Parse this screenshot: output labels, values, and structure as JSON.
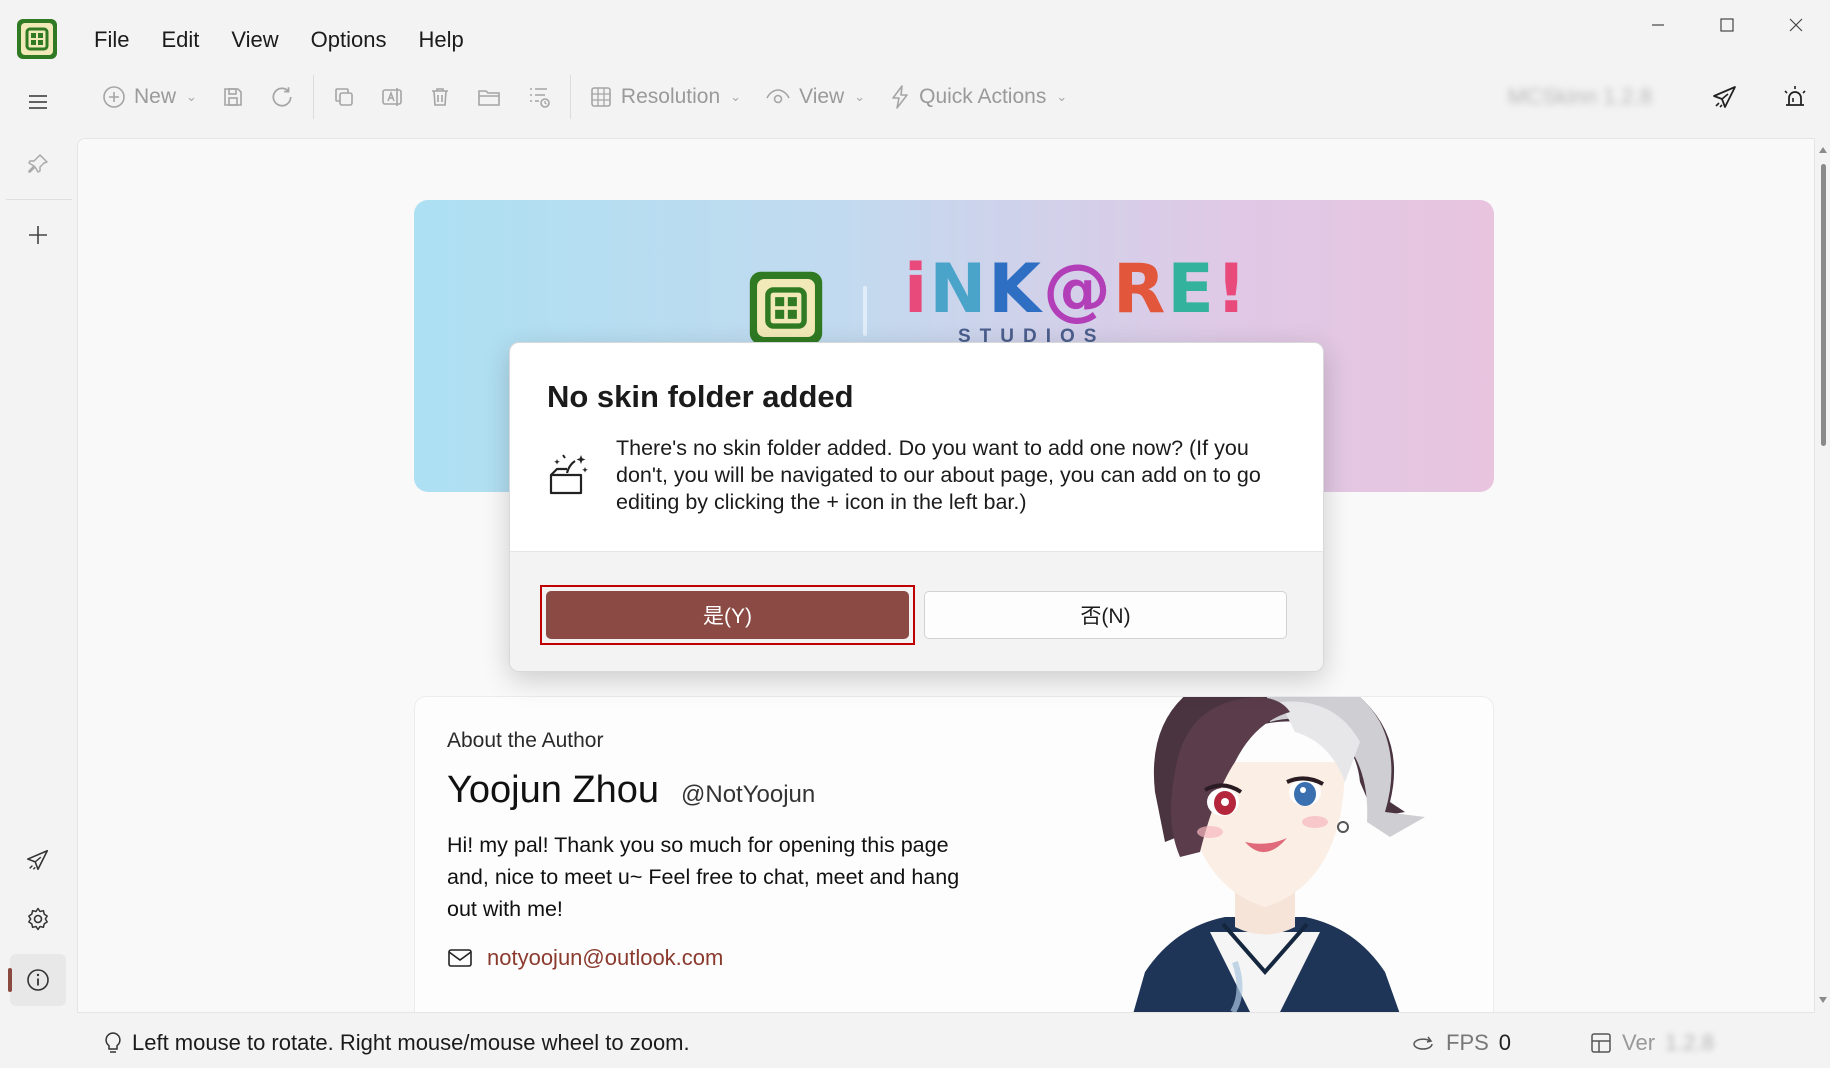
{
  "menu": {
    "items": [
      {
        "label": "File"
      },
      {
        "label": "Edit"
      },
      {
        "label": "View"
      },
      {
        "label": "Options"
      },
      {
        "label": "Help"
      }
    ]
  },
  "toolbar": {
    "new_label": "New",
    "resolution_label": "Resolution",
    "view_label": "View",
    "quick_actions_label": "Quick Actions",
    "app_name_blurred": "MCSkinn 1.2.8"
  },
  "banner": {
    "brand_letters": [
      "i",
      "N",
      "K",
      "@",
      "R",
      "E",
      "!"
    ],
    "brand_sub": "STUDIOS"
  },
  "author": {
    "section_label": "About the Author",
    "name": "Yoojun Zhou",
    "handle": "@NotYoojun",
    "bio": "Hi! my pal! Thank you so much for opening this page and, nice to meet u~ Feel free to chat, meet and hang out with me!",
    "email": "notyoojun@outlook.com"
  },
  "dialog": {
    "title": "No skin folder added",
    "message": "There's no skin folder added. Do you want to add one now? (If you don't, you will be navigated to our about page, you can add on to go editing by clicking the + icon in the left bar.)",
    "yes_label": "是(Y)",
    "no_label": "否(N)"
  },
  "status": {
    "hint": "Left mouse to rotate. Right mouse/mouse wheel to zoom.",
    "fps_label": "FPS",
    "fps_value": "0",
    "ver_label": "Ver",
    "ver_value": "1.2.8"
  },
  "colors": {
    "accent": "#8b4a44",
    "focus_ring": "#c00000",
    "email_link": "#8b3a2e"
  }
}
